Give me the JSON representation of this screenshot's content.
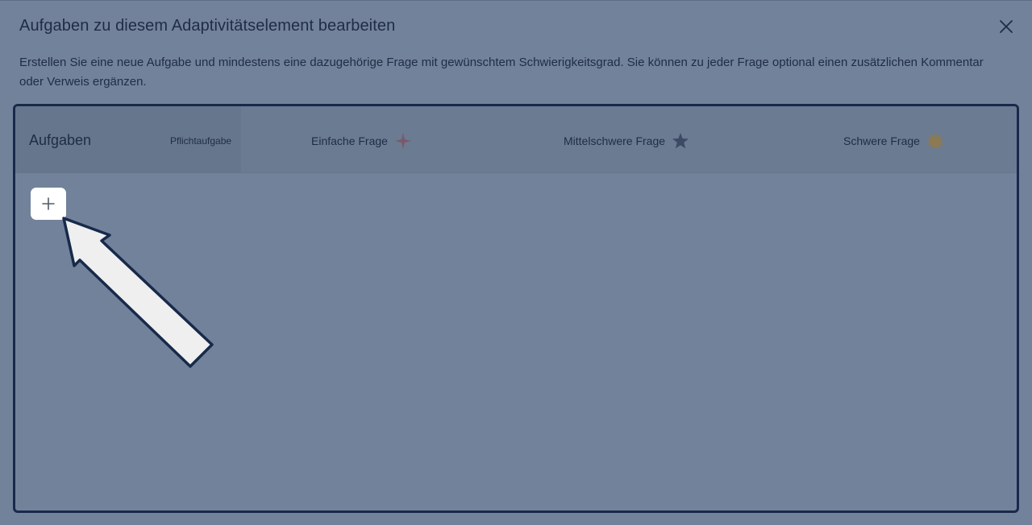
{
  "dialog": {
    "title": "Aufgaben zu diesem Adaptivitätselement bearbeiten",
    "description": "Erstellen Sie eine neue Aufgabe und mindestens eine dazugehörige Frage mit gewünschtem Schwierigkeitsgrad. Sie können zu jeder Frage optional einen zusätzlichen Kommentar oder Verweis ergänzen.",
    "close_icon": "close-icon"
  },
  "table": {
    "tasks_header": "Aufgaben",
    "required_header": "Pflichtaufgabe",
    "columns": [
      {
        "label": "Einfache Frage",
        "icon": "sparkle-star-icon",
        "color": "#7a5a6a"
      },
      {
        "label": "Mittelschwere Frage",
        "icon": "star-icon",
        "color": "#3c4a64"
      },
      {
        "label": "Schwere Frage",
        "icon": "spiked-star-icon",
        "color": "#8c7a52"
      }
    ]
  },
  "add_task": {
    "icon": "plus-icon"
  },
  "overlay": {
    "pointer_icon": "arrow-pointer-icon",
    "pointer_fill": "#efefef",
    "pointer_stroke": "#172a4b"
  },
  "colors": {
    "backdrop": "#72829a",
    "text": "#1f2d44",
    "frame_border": "#172a4b"
  }
}
